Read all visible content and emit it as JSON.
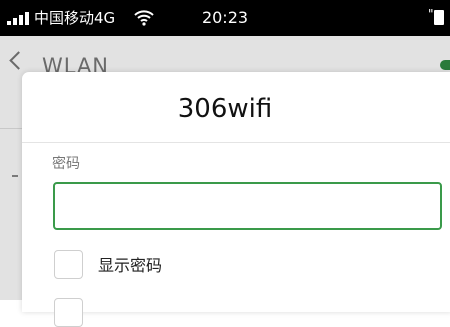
{
  "status_bar": {
    "carrier": "中国移动4G",
    "time": "20:23"
  },
  "background": {
    "title": "WLAN"
  },
  "dialog": {
    "title": "306wifi",
    "password_label": "密码",
    "password_value": "",
    "show_password_label": "显示密码",
    "show_password_checked": false,
    "accent_color": "#3a9a4a"
  }
}
